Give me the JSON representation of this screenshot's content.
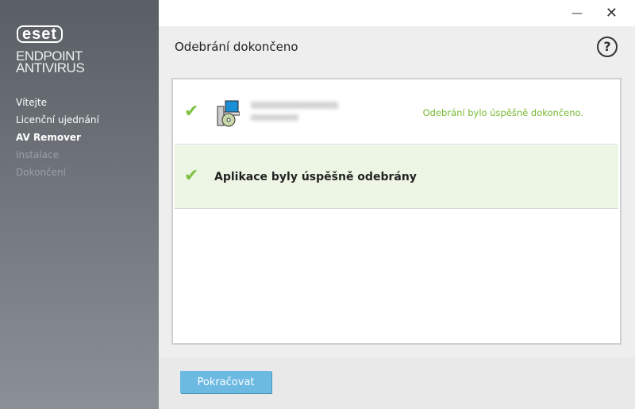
{
  "sidebar": {
    "logo": "eset",
    "product_line1": "ENDPOINT",
    "product_line2": "ANTIVIRUS",
    "items": [
      {
        "label": "Vítejte",
        "state": "done"
      },
      {
        "label": "Licenční ujednání",
        "state": "done"
      },
      {
        "label": "AV Remover",
        "state": "active"
      },
      {
        "label": "Instalace",
        "state": "disabled"
      },
      {
        "label": "Dokončení",
        "state": "disabled"
      }
    ]
  },
  "window": {
    "minimize": "—",
    "close": "✕"
  },
  "header": {
    "title": "Odebrání dokončeno",
    "help": "?"
  },
  "results": {
    "item_status": "Odebrání bylo úspěšně dokončeno.",
    "summary": "Aplikace byly úspěšně odebrány",
    "check": "✔"
  },
  "footer": {
    "continue_label": "Pokračovat"
  }
}
